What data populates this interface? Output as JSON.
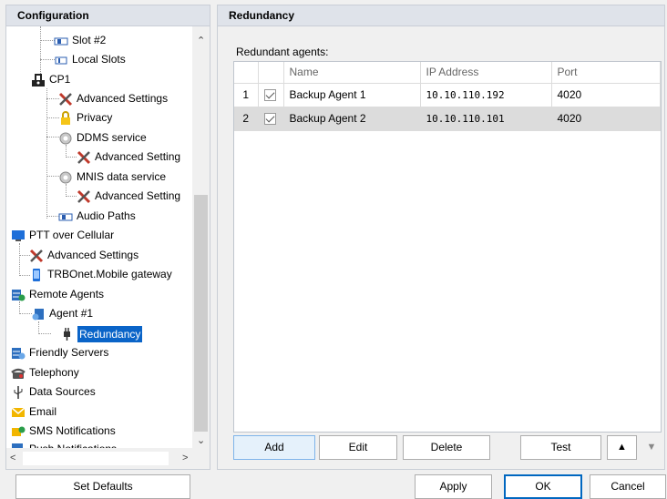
{
  "left_panel": {
    "title": "Configuration",
    "tree": [
      {
        "label": "Slot #2",
        "icon": "slot-icon"
      },
      {
        "label": "Local Slots",
        "icon": "local-slots-icon"
      },
      {
        "label": "CP1",
        "icon": "site-icon"
      },
      {
        "label": "Advanced Settings",
        "icon": "tools-icon"
      },
      {
        "label": "Privacy",
        "icon": "lock-icon"
      },
      {
        "label": "DDMS service",
        "icon": "gear-icon"
      },
      {
        "label": "Advanced Setting",
        "icon": "tools-icon"
      },
      {
        "label": "MNIS data service",
        "icon": "gear-icon"
      },
      {
        "label": "Advanced Setting",
        "icon": "tools-icon"
      },
      {
        "label": "Audio Paths",
        "icon": "audio-paths-icon"
      },
      {
        "label": "PTT over Cellular",
        "icon": "monitor-icon"
      },
      {
        "label": "Advanced Settings",
        "icon": "tools-icon"
      },
      {
        "label": "TRBOnet.Mobile gateway",
        "icon": "phone-icon"
      },
      {
        "label": "Remote Agents",
        "icon": "server-icon"
      },
      {
        "label": "Agent #1",
        "icon": "agent-icon"
      },
      {
        "label": "Redundancy",
        "icon": "plug-icon"
      },
      {
        "label": "Friendly Servers",
        "icon": "server-icon"
      },
      {
        "label": "Telephony",
        "icon": "telephone-icon"
      },
      {
        "label": "Data Sources",
        "icon": "usb-icon"
      },
      {
        "label": "Email",
        "icon": "envelope-icon"
      },
      {
        "label": "SMS Notifications",
        "icon": "sms-icon"
      },
      {
        "label": "Push Notifications",
        "icon": "push-icon"
      }
    ]
  },
  "right_panel": {
    "title": "Redundancy",
    "agents_label": "Redundant agents:",
    "columns": [
      "Name",
      "IP Address",
      "Port"
    ],
    "rows": [
      {
        "num": "1",
        "checked": true,
        "name": "Backup Agent 1",
        "ip": "10.10.110.192",
        "port": "4020"
      },
      {
        "num": "2",
        "checked": true,
        "name": "Backup Agent 2",
        "ip": "10.10.110.101",
        "port": "4020"
      }
    ]
  },
  "buttons": {
    "add": "Add",
    "edit": "Edit",
    "delete": "Delete",
    "test": "Test",
    "up": "▲",
    "down": "▼",
    "set_defaults": "Set Defaults",
    "apply": "Apply",
    "ok": "OK",
    "cancel": "Cancel"
  },
  "colors": {
    "selection": "#0a64c8",
    "header": "#dfe3ea",
    "ok_border": "#0067c0"
  }
}
